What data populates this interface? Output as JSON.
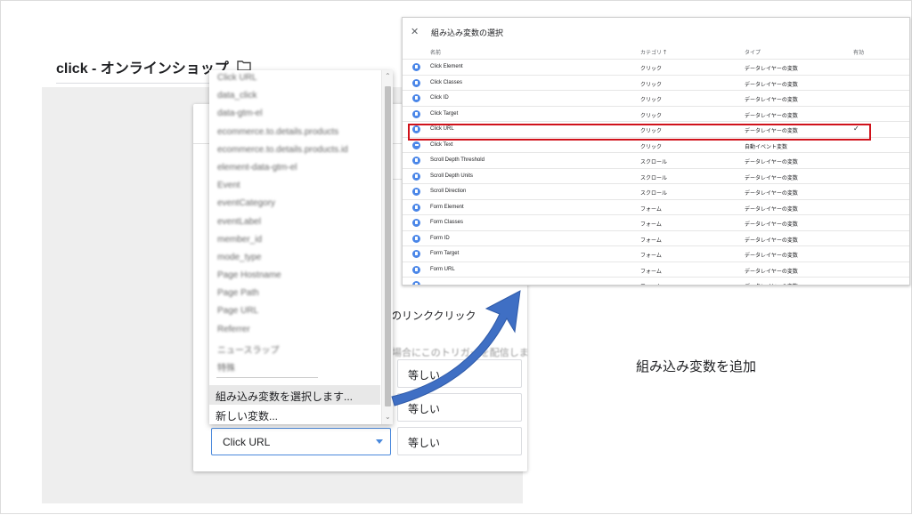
{
  "page": {
    "title": "click - オンラインショップ"
  },
  "trigger_card": {
    "name_label": "のリンククリック",
    "condition_caption": "の場合にこのトリガーを配信しま",
    "operators": [
      "等しい",
      "等しい",
      "等しい"
    ],
    "selected_variable": "Click URL"
  },
  "dropdown": {
    "blurred_items": [
      "Click URL",
      "data_click",
      "data-gtm-el",
      "ecommerce.to.details.products",
      "ecommerce.to.details.products.id",
      "element-data-gtm-el",
      "Event",
      "eventCategory",
      "eventLabel",
      "member_id",
      "mode_type",
      "Page Hostname",
      "Page Path",
      "Page URL",
      "Referrer",
      "ニュースラップ",
      "特殊"
    ],
    "builtin_option": "組み込み変数を選択します...",
    "new_option": "新しい変数..."
  },
  "builtin_panel": {
    "title": "組み込み変数の選択",
    "columns": {
      "name": "名前",
      "category": "カテゴリ",
      "type": "タイプ",
      "enabled": "有効"
    },
    "sort_indicator": "🡑",
    "rows": [
      {
        "name": "Click Element",
        "category": "クリック",
        "type": "データレイヤーの変数",
        "enabled": "",
        "icon": "datalayer-icon"
      },
      {
        "name": "Click Classes",
        "category": "クリック",
        "type": "データレイヤーの変数",
        "enabled": "",
        "icon": "datalayer-icon"
      },
      {
        "name": "Click ID",
        "category": "クリック",
        "type": "データレイヤーの変数",
        "enabled": "",
        "icon": "datalayer-icon"
      },
      {
        "name": "Click Target",
        "category": "クリック",
        "type": "データレイヤーの変数",
        "enabled": "",
        "icon": "datalayer-icon"
      },
      {
        "name": "Click URL",
        "category": "クリック",
        "type": "データレイヤーの変数",
        "enabled": "✓",
        "icon": "datalayer-icon"
      },
      {
        "name": "Click Text",
        "category": "クリック",
        "type": "自動イベント変数",
        "enabled": "",
        "icon": "auto-event-icon"
      },
      {
        "name": "Scroll Depth Threshold",
        "category": "スクロール",
        "type": "データレイヤーの変数",
        "enabled": "",
        "icon": "datalayer-icon"
      },
      {
        "name": "Scroll Depth Units",
        "category": "スクロール",
        "type": "データレイヤーの変数",
        "enabled": "",
        "icon": "datalayer-icon"
      },
      {
        "name": "Scroll Direction",
        "category": "スクロール",
        "type": "データレイヤーの変数",
        "enabled": "",
        "icon": "datalayer-icon"
      },
      {
        "name": "Form Element",
        "category": "フォーム",
        "type": "データレイヤーの変数",
        "enabled": "",
        "icon": "datalayer-icon"
      },
      {
        "name": "Form Classes",
        "category": "フォーム",
        "type": "データレイヤーの変数",
        "enabled": "",
        "icon": "datalayer-icon"
      },
      {
        "name": "Form ID",
        "category": "フォーム",
        "type": "データレイヤーの変数",
        "enabled": "",
        "icon": "datalayer-icon"
      },
      {
        "name": "Form Target",
        "category": "フォーム",
        "type": "データレイヤーの変数",
        "enabled": "",
        "icon": "datalayer-icon"
      },
      {
        "name": "Form URL",
        "category": "フォーム",
        "type": "データレイヤーの変数",
        "enabled": "",
        "icon": "datalayer-icon"
      },
      {
        "name": "",
        "category": "フォーム",
        "type": "データレイヤーの変数",
        "enabled": "",
        "icon": "datalayer-icon"
      }
    ]
  },
  "caption": "組み込み変数を追加",
  "colors": {
    "highlight": "#d0121b",
    "arrow": "#3f6fc4",
    "accent": "#4a89dc"
  }
}
